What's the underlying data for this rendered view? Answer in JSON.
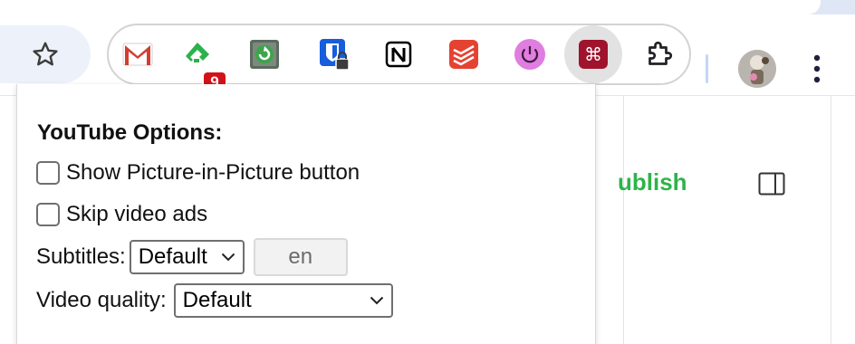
{
  "toolbar": {
    "bookmark_icon": "star-icon",
    "extensions": [
      {
        "name": "gmail-icon",
        "color": "#d23f31"
      },
      {
        "name": "feedly-icon",
        "color": "#2bb24c",
        "badge": "9"
      },
      {
        "name": "refresh-extension-icon",
        "color": "#3fa34d"
      },
      {
        "name": "bitwarden-icon",
        "color": "#175ddc"
      },
      {
        "name": "notion-icon",
        "color": "#000000"
      },
      {
        "name": "todoist-icon",
        "color": "#e44332"
      },
      {
        "name": "power-icon",
        "color": "#e07de0"
      },
      {
        "name": "command-icon",
        "color": "#a0132c"
      },
      {
        "name": "puzzle-icon",
        "color": "#202124"
      }
    ],
    "avatar": "avatar",
    "menu_icon": "kebab-menu-icon"
  },
  "page": {
    "publish_label": "ublish",
    "publish_color": "#2eb34a"
  },
  "popup": {
    "heading": "YouTube Options:",
    "options": [
      {
        "label": "Show Picture-in-Picture button",
        "checked": false
      },
      {
        "label": "Skip video ads",
        "checked": false
      }
    ],
    "subtitles": {
      "label": "Subtitles:",
      "selected": "Default",
      "language": "en"
    },
    "quality": {
      "label": "Video quality:",
      "selected": "Default"
    }
  }
}
